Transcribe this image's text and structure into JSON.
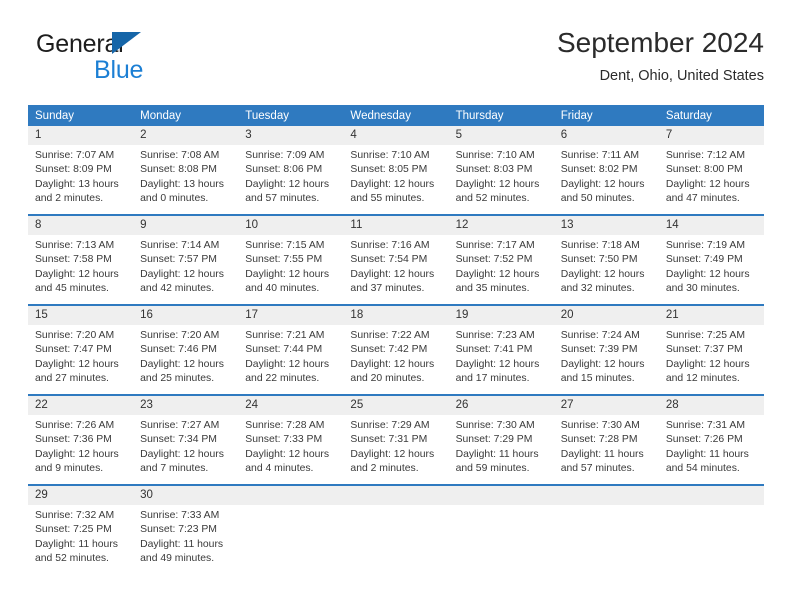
{
  "brand": {
    "name_top": "General",
    "name_bottom": "Blue",
    "color_dark": "#1d1d1d",
    "color_blue": "#1c7fd4",
    "triangle_color": "#1565a8"
  },
  "header": {
    "month_title": "September 2024",
    "location": "Dent, Ohio, United States"
  },
  "theme": {
    "header_bg": "#2f7ac0",
    "header_text": "#ffffff",
    "daynum_bg": "#efefef",
    "cell_bg": "#ffffff",
    "text": "#3a3a3a"
  },
  "weekdays": [
    "Sunday",
    "Monday",
    "Tuesday",
    "Wednesday",
    "Thursday",
    "Friday",
    "Saturday"
  ],
  "weeks": [
    [
      {
        "day": "1",
        "sunrise": "Sunrise: 7:07 AM",
        "sunset": "Sunset: 8:09 PM",
        "daylight_1": "Daylight: 13 hours",
        "daylight_2": "and 2 minutes."
      },
      {
        "day": "2",
        "sunrise": "Sunrise: 7:08 AM",
        "sunset": "Sunset: 8:08 PM",
        "daylight_1": "Daylight: 13 hours",
        "daylight_2": "and 0 minutes."
      },
      {
        "day": "3",
        "sunrise": "Sunrise: 7:09 AM",
        "sunset": "Sunset: 8:06 PM",
        "daylight_1": "Daylight: 12 hours",
        "daylight_2": "and 57 minutes."
      },
      {
        "day": "4",
        "sunrise": "Sunrise: 7:10 AM",
        "sunset": "Sunset: 8:05 PM",
        "daylight_1": "Daylight: 12 hours",
        "daylight_2": "and 55 minutes."
      },
      {
        "day": "5",
        "sunrise": "Sunrise: 7:10 AM",
        "sunset": "Sunset: 8:03 PM",
        "daylight_1": "Daylight: 12 hours",
        "daylight_2": "and 52 minutes."
      },
      {
        "day": "6",
        "sunrise": "Sunrise: 7:11 AM",
        "sunset": "Sunset: 8:02 PM",
        "daylight_1": "Daylight: 12 hours",
        "daylight_2": "and 50 minutes."
      },
      {
        "day": "7",
        "sunrise": "Sunrise: 7:12 AM",
        "sunset": "Sunset: 8:00 PM",
        "daylight_1": "Daylight: 12 hours",
        "daylight_2": "and 47 minutes."
      }
    ],
    [
      {
        "day": "8",
        "sunrise": "Sunrise: 7:13 AM",
        "sunset": "Sunset: 7:58 PM",
        "daylight_1": "Daylight: 12 hours",
        "daylight_2": "and 45 minutes."
      },
      {
        "day": "9",
        "sunrise": "Sunrise: 7:14 AM",
        "sunset": "Sunset: 7:57 PM",
        "daylight_1": "Daylight: 12 hours",
        "daylight_2": "and 42 minutes."
      },
      {
        "day": "10",
        "sunrise": "Sunrise: 7:15 AM",
        "sunset": "Sunset: 7:55 PM",
        "daylight_1": "Daylight: 12 hours",
        "daylight_2": "and 40 minutes."
      },
      {
        "day": "11",
        "sunrise": "Sunrise: 7:16 AM",
        "sunset": "Sunset: 7:54 PM",
        "daylight_1": "Daylight: 12 hours",
        "daylight_2": "and 37 minutes."
      },
      {
        "day": "12",
        "sunrise": "Sunrise: 7:17 AM",
        "sunset": "Sunset: 7:52 PM",
        "daylight_1": "Daylight: 12 hours",
        "daylight_2": "and 35 minutes."
      },
      {
        "day": "13",
        "sunrise": "Sunrise: 7:18 AM",
        "sunset": "Sunset: 7:50 PM",
        "daylight_1": "Daylight: 12 hours",
        "daylight_2": "and 32 minutes."
      },
      {
        "day": "14",
        "sunrise": "Sunrise: 7:19 AM",
        "sunset": "Sunset: 7:49 PM",
        "daylight_1": "Daylight: 12 hours",
        "daylight_2": "and 30 minutes."
      }
    ],
    [
      {
        "day": "15",
        "sunrise": "Sunrise: 7:20 AM",
        "sunset": "Sunset: 7:47 PM",
        "daylight_1": "Daylight: 12 hours",
        "daylight_2": "and 27 minutes."
      },
      {
        "day": "16",
        "sunrise": "Sunrise: 7:20 AM",
        "sunset": "Sunset: 7:46 PM",
        "daylight_1": "Daylight: 12 hours",
        "daylight_2": "and 25 minutes."
      },
      {
        "day": "17",
        "sunrise": "Sunrise: 7:21 AM",
        "sunset": "Sunset: 7:44 PM",
        "daylight_1": "Daylight: 12 hours",
        "daylight_2": "and 22 minutes."
      },
      {
        "day": "18",
        "sunrise": "Sunrise: 7:22 AM",
        "sunset": "Sunset: 7:42 PM",
        "daylight_1": "Daylight: 12 hours",
        "daylight_2": "and 20 minutes."
      },
      {
        "day": "19",
        "sunrise": "Sunrise: 7:23 AM",
        "sunset": "Sunset: 7:41 PM",
        "daylight_1": "Daylight: 12 hours",
        "daylight_2": "and 17 minutes."
      },
      {
        "day": "20",
        "sunrise": "Sunrise: 7:24 AM",
        "sunset": "Sunset: 7:39 PM",
        "daylight_1": "Daylight: 12 hours",
        "daylight_2": "and 15 minutes."
      },
      {
        "day": "21",
        "sunrise": "Sunrise: 7:25 AM",
        "sunset": "Sunset: 7:37 PM",
        "daylight_1": "Daylight: 12 hours",
        "daylight_2": "and 12 minutes."
      }
    ],
    [
      {
        "day": "22",
        "sunrise": "Sunrise: 7:26 AM",
        "sunset": "Sunset: 7:36 PM",
        "daylight_1": "Daylight: 12 hours",
        "daylight_2": "and 9 minutes."
      },
      {
        "day": "23",
        "sunrise": "Sunrise: 7:27 AM",
        "sunset": "Sunset: 7:34 PM",
        "daylight_1": "Daylight: 12 hours",
        "daylight_2": "and 7 minutes."
      },
      {
        "day": "24",
        "sunrise": "Sunrise: 7:28 AM",
        "sunset": "Sunset: 7:33 PM",
        "daylight_1": "Daylight: 12 hours",
        "daylight_2": "and 4 minutes."
      },
      {
        "day": "25",
        "sunrise": "Sunrise: 7:29 AM",
        "sunset": "Sunset: 7:31 PM",
        "daylight_1": "Daylight: 12 hours",
        "daylight_2": "and 2 minutes."
      },
      {
        "day": "26",
        "sunrise": "Sunrise: 7:30 AM",
        "sunset": "Sunset: 7:29 PM",
        "daylight_1": "Daylight: 11 hours",
        "daylight_2": "and 59 minutes."
      },
      {
        "day": "27",
        "sunrise": "Sunrise: 7:30 AM",
        "sunset": "Sunset: 7:28 PM",
        "daylight_1": "Daylight: 11 hours",
        "daylight_2": "and 57 minutes."
      },
      {
        "day": "28",
        "sunrise": "Sunrise: 7:31 AM",
        "sunset": "Sunset: 7:26 PM",
        "daylight_1": "Daylight: 11 hours",
        "daylight_2": "and 54 minutes."
      }
    ],
    [
      {
        "day": "29",
        "sunrise": "Sunrise: 7:32 AM",
        "sunset": "Sunset: 7:25 PM",
        "daylight_1": "Daylight: 11 hours",
        "daylight_2": "and 52 minutes."
      },
      {
        "day": "30",
        "sunrise": "Sunrise: 7:33 AM",
        "sunset": "Sunset: 7:23 PM",
        "daylight_1": "Daylight: 11 hours",
        "daylight_2": "and 49 minutes."
      },
      {
        "day": "",
        "sunrise": "",
        "sunset": "",
        "daylight_1": "",
        "daylight_2": ""
      },
      {
        "day": "",
        "sunrise": "",
        "sunset": "",
        "daylight_1": "",
        "daylight_2": ""
      },
      {
        "day": "",
        "sunrise": "",
        "sunset": "",
        "daylight_1": "",
        "daylight_2": ""
      },
      {
        "day": "",
        "sunrise": "",
        "sunset": "",
        "daylight_1": "",
        "daylight_2": ""
      },
      {
        "day": "",
        "sunrise": "",
        "sunset": "",
        "daylight_1": "",
        "daylight_2": ""
      }
    ]
  ]
}
